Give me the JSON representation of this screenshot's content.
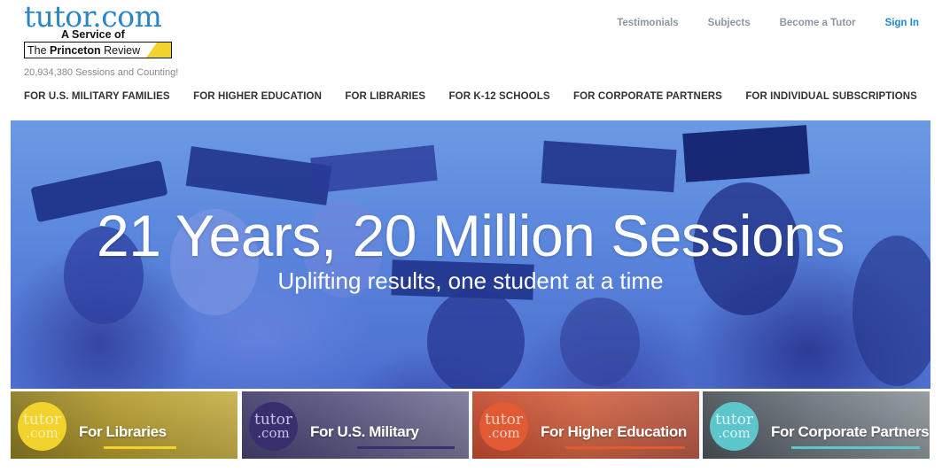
{
  "logo": {
    "word": "tutor",
    "dot": ".",
    "com": "com",
    "service": "A Service of",
    "tpr_the": "The ",
    "tpr_princeton": "Princeton",
    "tpr_review": " Review"
  },
  "sessions_count": "20,934,380 Sessions and Counting!",
  "top_links": {
    "testimonials": "Testimonials",
    "subjects": "Subjects",
    "become_tutor": "Become a Tutor",
    "sign_in": "Sign In"
  },
  "main_nav": [
    "FOR U.S. MILITARY FAMILIES",
    "FOR HIGHER EDUCATION",
    "FOR LIBRARIES",
    "FOR K-12 SCHOOLS",
    "FOR CORPORATE PARTNERS",
    "FOR INDIVIDUAL SUBSCRIPTIONS"
  ],
  "hero": {
    "title": "21 Years, 20 Million Sessions",
    "subtitle": "Uplifting results, one student at a time"
  },
  "tiles": [
    {
      "circle_top": "tutor",
      "circle_bottom": ".com",
      "label": "For Libraries",
      "accent": "#f2d32e"
    },
    {
      "circle_top": "tutor",
      "circle_bottom": ".com",
      "label": "For U.S. Military",
      "accent": "#3a2f6e"
    },
    {
      "circle_top": "tutor",
      "circle_bottom": ".com",
      "label": "For Higher Education",
      "accent": "#e25a34"
    },
    {
      "circle_top": "tutor",
      "circle_bottom": ".com",
      "label": "For Corporate Partners",
      "accent": "#5cc6cc"
    }
  ]
}
